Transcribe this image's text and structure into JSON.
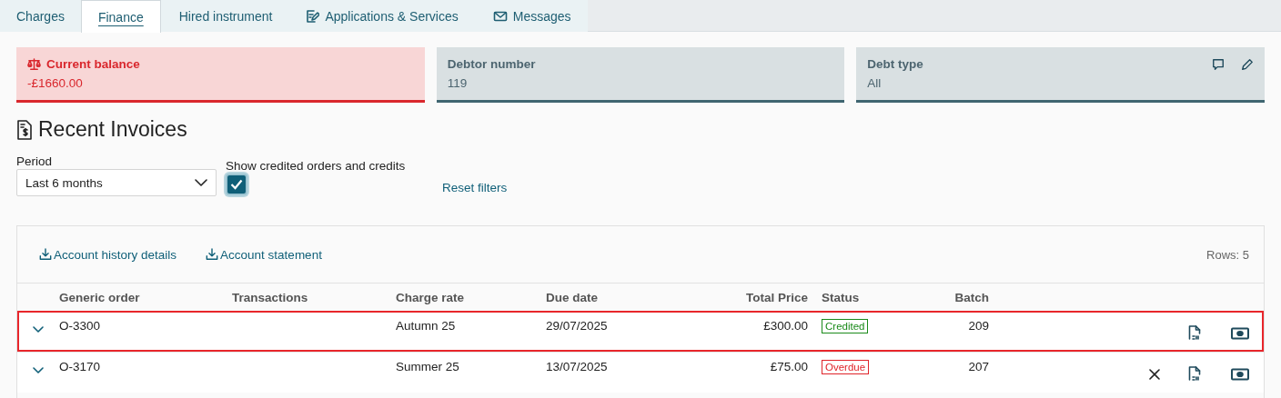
{
  "tabs": [
    {
      "label": "Charges",
      "selected": false,
      "kind": "plain"
    },
    {
      "label": "Finance",
      "selected": true,
      "kind": "plain"
    },
    {
      "label": "Hired instrument",
      "selected": false,
      "kind": "plain"
    },
    {
      "label": "Applications & Services",
      "selected": false,
      "kind": "form"
    },
    {
      "label": "Messages",
      "selected": false,
      "kind": "mail"
    }
  ],
  "summary_cards": [
    {
      "kind": "alert",
      "label": "Current balance",
      "value": "-£1660.00"
    },
    {
      "kind": "info",
      "label": "Debtor number",
      "value": "119"
    },
    {
      "kind": "editable",
      "label": "Debt type",
      "value": "All"
    }
  ],
  "section_title": "Recent Invoices",
  "filters": {
    "period": {
      "label": "Period",
      "value": "Last 6 months"
    },
    "show_credited": {
      "label": "Show credited orders and credits",
      "checked": true
    },
    "reset": "Reset filters"
  },
  "table": {
    "toolbar_links": [
      "Account history details",
      "Account statement"
    ],
    "row_count": "Rows: 5",
    "columns": [
      "Generic order",
      "Transactions",
      "Charge rate",
      "Due date",
      "Total Price",
      "Status",
      "Batch"
    ],
    "rows": [
      {
        "selected": true,
        "expanded": false,
        "generic_order": "O-3300",
        "charge_rate": "Autumn 25",
        "due_date": "29/07/2025",
        "total_price": "£300.00",
        "status": {
          "label": "Credited",
          "color": "#1a8a1a"
        },
        "batch": "209",
        "cancellable": false
      },
      {
        "selected": false,
        "expanded": false,
        "generic_order": "O-3170",
        "charge_rate": "Summer 25",
        "due_date": "13/07/2025",
        "total_price": "£75.00",
        "status": {
          "label": "Overdue",
          "color": "#e0242a"
        },
        "batch": "207",
        "cancellable": true
      }
    ]
  }
}
